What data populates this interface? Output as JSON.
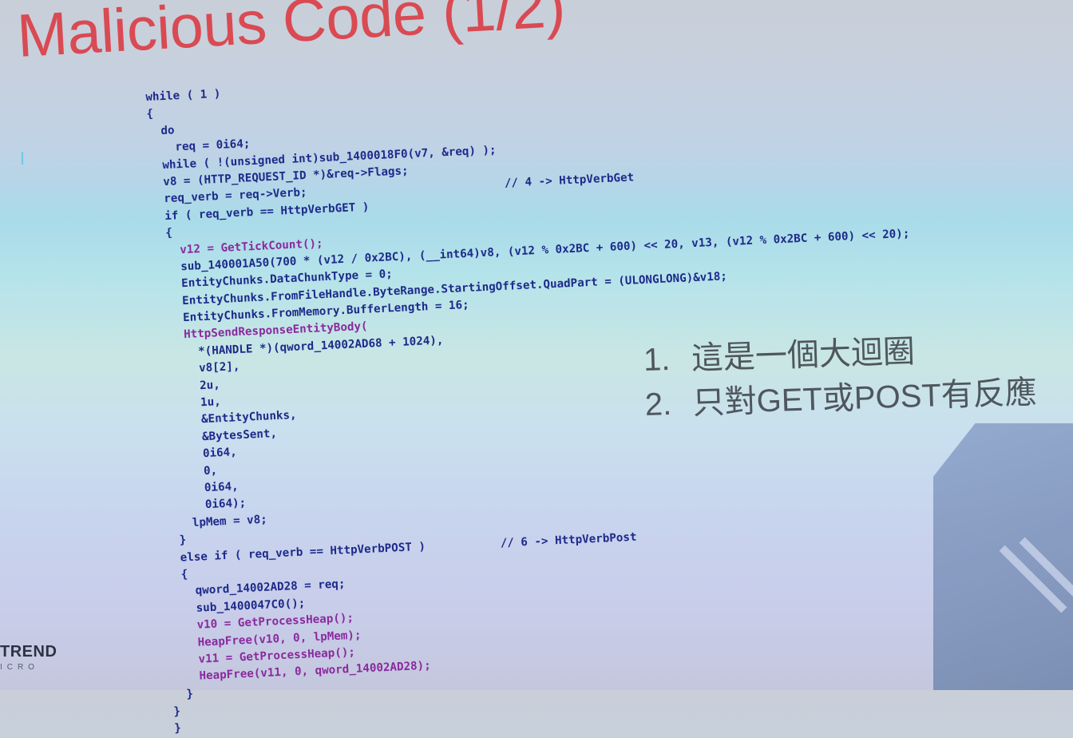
{
  "title": "Malicious Code (1/2)",
  "code_lines": [
    "while ( 1 )",
    "{",
    "  do",
    "    req = 0i64;",
    "  while ( !(unsigned int)sub_1400018F0(v7, &req) );",
    "  v8 = (HTTP_REQUEST_ID *)&req->Flags;",
    "  req_verb = req->Verb;                             // 4 -> HttpVerbGet",
    "  if ( req_verb == HttpVerbGET )",
    "  {",
    "    v12 = GetTickCount();",
    "    sub_140001A50(700 * (v12 / 0x2BC), (__int64)v8, (v12 % 0x2BC + 600) << 20, v13, (v12 % 0x2BC + 600) << 20);",
    "    EntityChunks.DataChunkType = 0;",
    "    EntityChunks.FromFileHandle.ByteRange.StartingOffset.QuadPart = (ULONGLONG)&v18;",
    "    EntityChunks.FromMemory.BufferLength = 16;",
    "    HttpSendResponseEntityBody(",
    "      *(HANDLE *)(qword_14002AD68 + 1024),",
    "      v8[2],",
    "      2u,",
    "      1u,",
    "      &EntityChunks,",
    "      &BytesSent,",
    "      0i64,",
    "      0,",
    "      0i64,",
    "      0i64);",
    "    lpMem = v8;",
    "  }",
    "  else if ( req_verb == HttpVerbPOST )           // 6 -> HttpVerbPost",
    "  {",
    "    qword_14002AD28 = req;",
    "    sub_1400047C0();",
    "    v10 = GetProcessHeap();",
    "    HeapFree(v10, 0, lpMem);",
    "    v11 = GetProcessHeap();",
    "    HeapFree(v11, 0, qword_14002AD28);",
    "  }",
    "}",
    "}"
  ],
  "bullets": [
    {
      "num": "1.",
      "text": "這是一個大迴圈"
    },
    {
      "num": "2.",
      "text": "只對GET或POST有反應"
    }
  ],
  "logo": {
    "name": "TREND",
    "sub": "ICRO"
  },
  "colors": {
    "title": "#d94a53",
    "code": "#1d2a8a",
    "function": "#c33bb6",
    "comment": "#1f8a4a",
    "bullet_text": "#4f565e"
  }
}
